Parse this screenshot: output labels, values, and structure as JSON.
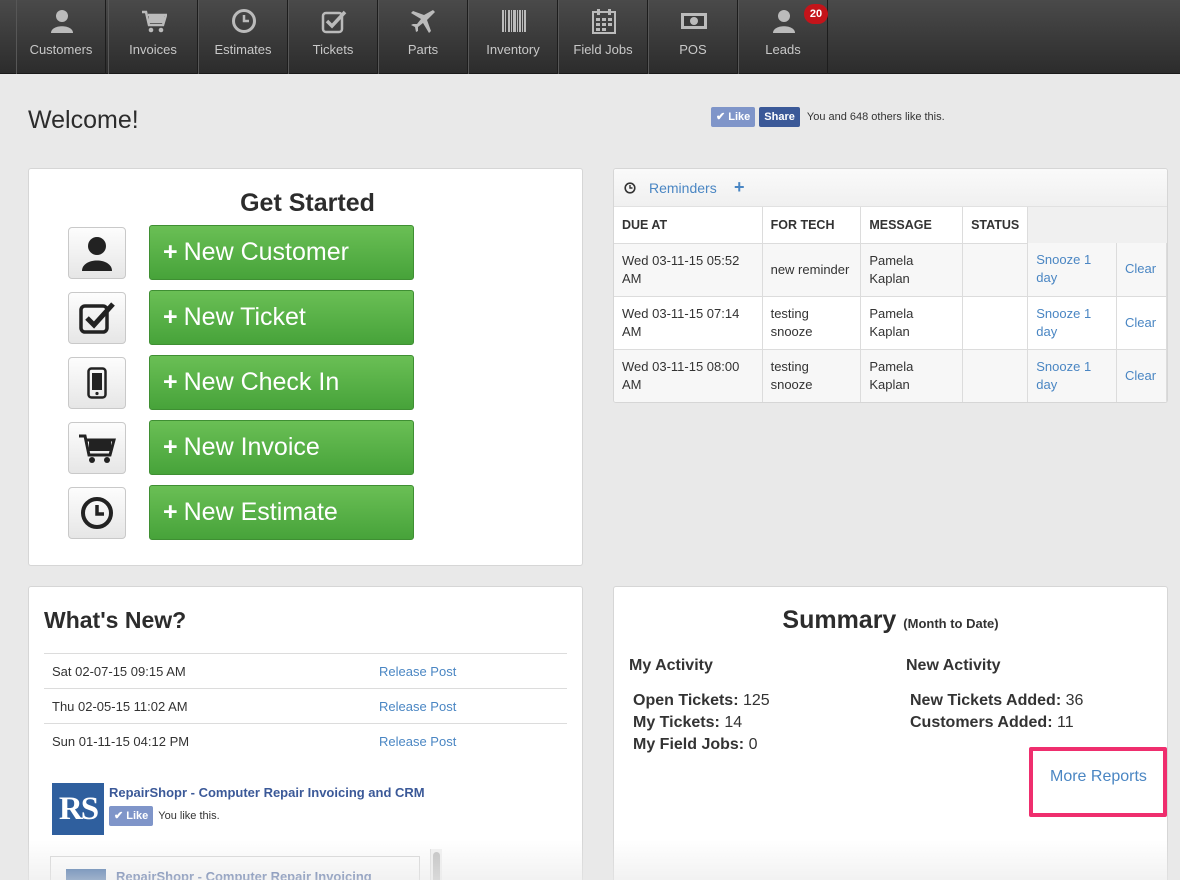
{
  "nav": {
    "items": [
      {
        "label": "Customers",
        "icon": "user-icon"
      },
      {
        "label": "Invoices",
        "icon": "cart-icon"
      },
      {
        "label": "Estimates",
        "icon": "clock-icon"
      },
      {
        "label": "Tickets",
        "icon": "checkbox-icon"
      },
      {
        "label": "Parts",
        "icon": "plane-icon"
      },
      {
        "label": "Inventory",
        "icon": "barcode-icon"
      },
      {
        "label": "Field Jobs",
        "icon": "calendar-icon"
      },
      {
        "label": "POS",
        "icon": "money-icon"
      },
      {
        "label": "Leads",
        "icon": "user-icon",
        "badge": "20"
      }
    ]
  },
  "header": {
    "title": "Welcome!",
    "like_label": "Like",
    "share_label": "Share",
    "like_text": "You and 648 others like this."
  },
  "get_started": {
    "title": "Get Started",
    "buttons": [
      {
        "label": "New Customer",
        "icon": "user-icon"
      },
      {
        "label": "New Ticket",
        "icon": "checkbox-icon"
      },
      {
        "label": "New Check In",
        "icon": "phone-icon"
      },
      {
        "label": "New Invoice",
        "icon": "cart-icon"
      },
      {
        "label": "New Estimate",
        "icon": "clock-icon"
      }
    ]
  },
  "reminders": {
    "title": "Reminders",
    "add_label": "+",
    "columns": [
      "DUE AT",
      "FOR TECH",
      "MESSAGE",
      "STATUS"
    ],
    "rows": [
      {
        "due": "Wed 03-11-15 05:52 AM",
        "message": "new reminder",
        "tech": "Pamela Kaplan",
        "status": "",
        "snooze": "Snooze 1 day",
        "clear": "Clear"
      },
      {
        "due": "Wed 03-11-15 07:14 AM",
        "message": "testing snooze",
        "tech": "Pamela Kaplan",
        "status": "",
        "snooze": "Snooze 1 day",
        "clear": "Clear"
      },
      {
        "due": "Wed 03-11-15 08:00 AM",
        "message": "testing snooze",
        "tech": "Pamela Kaplan",
        "status": "",
        "snooze": "Snooze 1 day",
        "clear": "Clear"
      }
    ]
  },
  "whats_new": {
    "title": "What's New?",
    "rows": [
      {
        "date": "Sat 02-07-15 09:15 AM",
        "link": "Release Post"
      },
      {
        "date": "Thu 02-05-15 11:02 AM",
        "link": "Release Post"
      },
      {
        "date": "Sun 01-11-15 04:12 PM",
        "link": "Release Post"
      }
    ],
    "fb_page": {
      "logo_text": "RS",
      "title": "RepairShopr - Computer Repair Invoicing and CRM",
      "like_label": "Like",
      "like_text": "You like this.",
      "embed_title": "RepairShopr - Computer Repair Invoicing"
    }
  },
  "summary": {
    "title": "Summary",
    "subtitle": "(Month to Date)",
    "my_activity": {
      "heading": "My Activity",
      "items": [
        {
          "label": "Open Tickets:",
          "value": "125"
        },
        {
          "label": "My Tickets:",
          "value": "14"
        },
        {
          "label": "My Field Jobs:",
          "value": "0"
        }
      ]
    },
    "new_activity": {
      "heading": "New Activity",
      "items": [
        {
          "label": "New Tickets Added:",
          "value": "36"
        },
        {
          "label": "Customers Added:",
          "value": "11"
        }
      ]
    },
    "more_reports": "More Reports"
  },
  "colors": {
    "accent_link": "#4a86c3",
    "button_green": "#55b043",
    "badge_red": "#c4141a",
    "highlight_pink": "#ef2e6e"
  }
}
